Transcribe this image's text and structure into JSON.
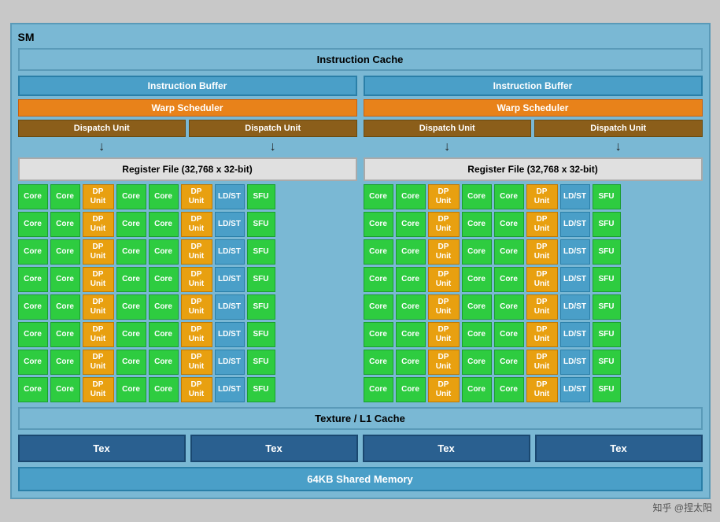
{
  "sm_label": "SM",
  "instruction_cache": "Instruction Cache",
  "left": {
    "instruction_buffer": "Instruction Buffer",
    "warp_scheduler": "Warp Scheduler",
    "dispatch_unit1": "Dispatch Unit",
    "dispatch_unit2": "Dispatch Unit",
    "register_file": "Register File (32,768 x 32-bit)"
  },
  "right": {
    "instruction_buffer": "Instruction Buffer",
    "warp_scheduler": "Warp Scheduler",
    "dispatch_unit1": "Dispatch Unit",
    "dispatch_unit2": "Dispatch Unit",
    "register_file": "Register File (32,768 x 32-bit)"
  },
  "core_label": "Core",
  "dp_unit_label": "DP\nUnit",
  "ldst_label": "LD/ST",
  "sfu_label": "SFU",
  "texture_l1": "Texture / L1 Cache",
  "tex_label": "Tex",
  "shared_memory": "64KB Shared Memory",
  "watermark": "知乎 @捏太阳",
  "rows_count": 8
}
